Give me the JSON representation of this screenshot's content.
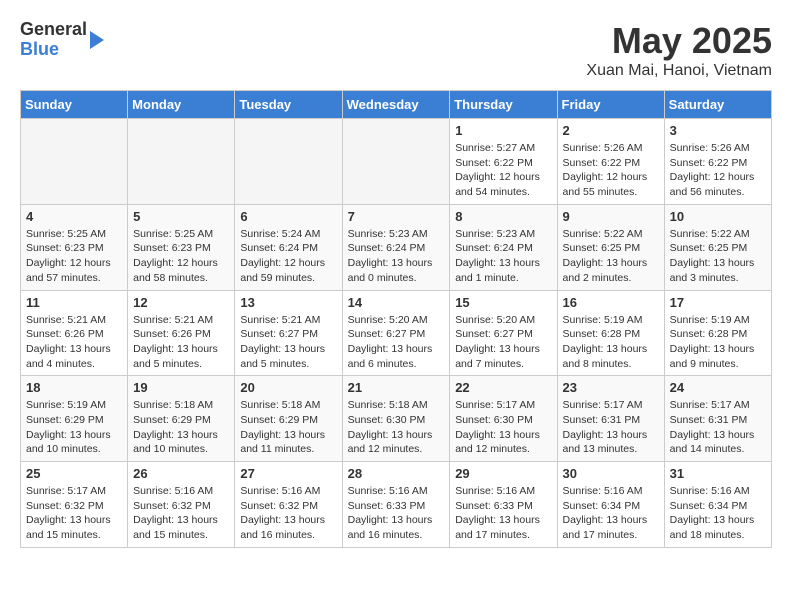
{
  "header": {
    "logo_general": "General",
    "logo_blue": "Blue",
    "title": "May 2025",
    "subtitle": "Xuan Mai, Hanoi, Vietnam"
  },
  "weekdays": [
    "Sunday",
    "Monday",
    "Tuesday",
    "Wednesday",
    "Thursday",
    "Friday",
    "Saturday"
  ],
  "weeks": [
    [
      {
        "day": "",
        "info": ""
      },
      {
        "day": "",
        "info": ""
      },
      {
        "day": "",
        "info": ""
      },
      {
        "day": "",
        "info": ""
      },
      {
        "day": "1",
        "info": "Sunrise: 5:27 AM\nSunset: 6:22 PM\nDaylight: 12 hours\nand 54 minutes."
      },
      {
        "day": "2",
        "info": "Sunrise: 5:26 AM\nSunset: 6:22 PM\nDaylight: 12 hours\nand 55 minutes."
      },
      {
        "day": "3",
        "info": "Sunrise: 5:26 AM\nSunset: 6:22 PM\nDaylight: 12 hours\nand 56 minutes."
      }
    ],
    [
      {
        "day": "4",
        "info": "Sunrise: 5:25 AM\nSunset: 6:23 PM\nDaylight: 12 hours\nand 57 minutes."
      },
      {
        "day": "5",
        "info": "Sunrise: 5:25 AM\nSunset: 6:23 PM\nDaylight: 12 hours\nand 58 minutes."
      },
      {
        "day": "6",
        "info": "Sunrise: 5:24 AM\nSunset: 6:24 PM\nDaylight: 12 hours\nand 59 minutes."
      },
      {
        "day": "7",
        "info": "Sunrise: 5:23 AM\nSunset: 6:24 PM\nDaylight: 13 hours\nand 0 minutes."
      },
      {
        "day": "8",
        "info": "Sunrise: 5:23 AM\nSunset: 6:24 PM\nDaylight: 13 hours\nand 1 minute."
      },
      {
        "day": "9",
        "info": "Sunrise: 5:22 AM\nSunset: 6:25 PM\nDaylight: 13 hours\nand 2 minutes."
      },
      {
        "day": "10",
        "info": "Sunrise: 5:22 AM\nSunset: 6:25 PM\nDaylight: 13 hours\nand 3 minutes."
      }
    ],
    [
      {
        "day": "11",
        "info": "Sunrise: 5:21 AM\nSunset: 6:26 PM\nDaylight: 13 hours\nand 4 minutes."
      },
      {
        "day": "12",
        "info": "Sunrise: 5:21 AM\nSunset: 6:26 PM\nDaylight: 13 hours\nand 5 minutes."
      },
      {
        "day": "13",
        "info": "Sunrise: 5:21 AM\nSunset: 6:27 PM\nDaylight: 13 hours\nand 5 minutes."
      },
      {
        "day": "14",
        "info": "Sunrise: 5:20 AM\nSunset: 6:27 PM\nDaylight: 13 hours\nand 6 minutes."
      },
      {
        "day": "15",
        "info": "Sunrise: 5:20 AM\nSunset: 6:27 PM\nDaylight: 13 hours\nand 7 minutes."
      },
      {
        "day": "16",
        "info": "Sunrise: 5:19 AM\nSunset: 6:28 PM\nDaylight: 13 hours\nand 8 minutes."
      },
      {
        "day": "17",
        "info": "Sunrise: 5:19 AM\nSunset: 6:28 PM\nDaylight: 13 hours\nand 9 minutes."
      }
    ],
    [
      {
        "day": "18",
        "info": "Sunrise: 5:19 AM\nSunset: 6:29 PM\nDaylight: 13 hours\nand 10 minutes."
      },
      {
        "day": "19",
        "info": "Sunrise: 5:18 AM\nSunset: 6:29 PM\nDaylight: 13 hours\nand 10 minutes."
      },
      {
        "day": "20",
        "info": "Sunrise: 5:18 AM\nSunset: 6:29 PM\nDaylight: 13 hours\nand 11 minutes."
      },
      {
        "day": "21",
        "info": "Sunrise: 5:18 AM\nSunset: 6:30 PM\nDaylight: 13 hours\nand 12 minutes."
      },
      {
        "day": "22",
        "info": "Sunrise: 5:17 AM\nSunset: 6:30 PM\nDaylight: 13 hours\nand 12 minutes."
      },
      {
        "day": "23",
        "info": "Sunrise: 5:17 AM\nSunset: 6:31 PM\nDaylight: 13 hours\nand 13 minutes."
      },
      {
        "day": "24",
        "info": "Sunrise: 5:17 AM\nSunset: 6:31 PM\nDaylight: 13 hours\nand 14 minutes."
      }
    ],
    [
      {
        "day": "25",
        "info": "Sunrise: 5:17 AM\nSunset: 6:32 PM\nDaylight: 13 hours\nand 15 minutes."
      },
      {
        "day": "26",
        "info": "Sunrise: 5:16 AM\nSunset: 6:32 PM\nDaylight: 13 hours\nand 15 minutes."
      },
      {
        "day": "27",
        "info": "Sunrise: 5:16 AM\nSunset: 6:32 PM\nDaylight: 13 hours\nand 16 minutes."
      },
      {
        "day": "28",
        "info": "Sunrise: 5:16 AM\nSunset: 6:33 PM\nDaylight: 13 hours\nand 16 minutes."
      },
      {
        "day": "29",
        "info": "Sunrise: 5:16 AM\nSunset: 6:33 PM\nDaylight: 13 hours\nand 17 minutes."
      },
      {
        "day": "30",
        "info": "Sunrise: 5:16 AM\nSunset: 6:34 PM\nDaylight: 13 hours\nand 17 minutes."
      },
      {
        "day": "31",
        "info": "Sunrise: 5:16 AM\nSunset: 6:34 PM\nDaylight: 13 hours\nand 18 minutes."
      }
    ]
  ]
}
